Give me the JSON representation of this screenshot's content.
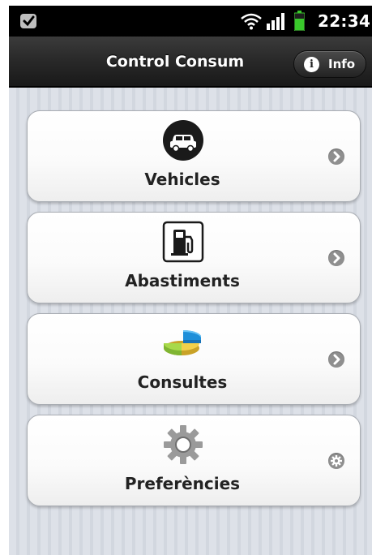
{
  "status_bar": {
    "time": "22:34",
    "icons": [
      "notification-icon",
      "wifi-icon",
      "signal-icon",
      "battery-icon"
    ]
  },
  "header": {
    "title": "Control Consum",
    "info_button": {
      "label": "Info",
      "icon": "info-icon"
    }
  },
  "menu": {
    "items": [
      {
        "label": "Vehicles",
        "icon": "car-icon",
        "trailing_icon": "chevron-right-icon"
      },
      {
        "label": "Abastiments",
        "icon": "fuel-pump-icon",
        "trailing_icon": "chevron-right-icon"
      },
      {
        "label": "Consultes",
        "icon": "pie-chart-icon",
        "trailing_icon": "chevron-right-icon"
      },
      {
        "label": "Preferències",
        "icon": "gear-icon",
        "trailing_icon": "settings-gear-icon"
      }
    ]
  },
  "colors": {
    "header_bg": "#2a2a2a",
    "content_bg": "#dde1e8",
    "item_bg": "#ffffff",
    "arrow_bg": "#8f8f8f",
    "battery_green": "#39c92b"
  }
}
